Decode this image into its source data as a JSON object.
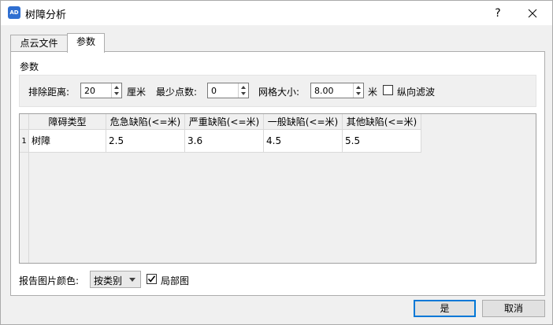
{
  "window": {
    "title": "树障分析",
    "app_icon_text": "AD",
    "help_label": "?"
  },
  "tabs": [
    {
      "label": "点云文件",
      "selected": false
    },
    {
      "label": "参数",
      "selected": true
    }
  ],
  "params": {
    "group_label": "参数",
    "exclude_distance": {
      "label": "排除距离:",
      "value": "20",
      "unit": "厘米"
    },
    "min_points": {
      "label": "最少点数:",
      "value": "0"
    },
    "grid_size": {
      "label": "网格大小:",
      "value": "8.00",
      "unit": "米"
    },
    "vertical_filter": {
      "label": "纵向滤波",
      "checked": false
    }
  },
  "table": {
    "columns": [
      "障碍类型",
      "危急缺陷(<=米)",
      "严重缺陷(<=米)",
      "一般缺陷(<=米)",
      "其他缺陷(<=米)"
    ],
    "rows": [
      {
        "index": "1",
        "cells": [
          "树障",
          "2.5",
          "3.6",
          "4.5",
          "5.5"
        ]
      }
    ]
  },
  "report": {
    "color_label": "报告图片颜色:",
    "color_value": "按类别",
    "local_map": {
      "label": "局部图",
      "checked": true
    }
  },
  "buttons": {
    "ok": "是",
    "cancel": "取消"
  },
  "colors": {
    "accent": "#0078d7",
    "icon_bg": "#2f6fd1"
  }
}
